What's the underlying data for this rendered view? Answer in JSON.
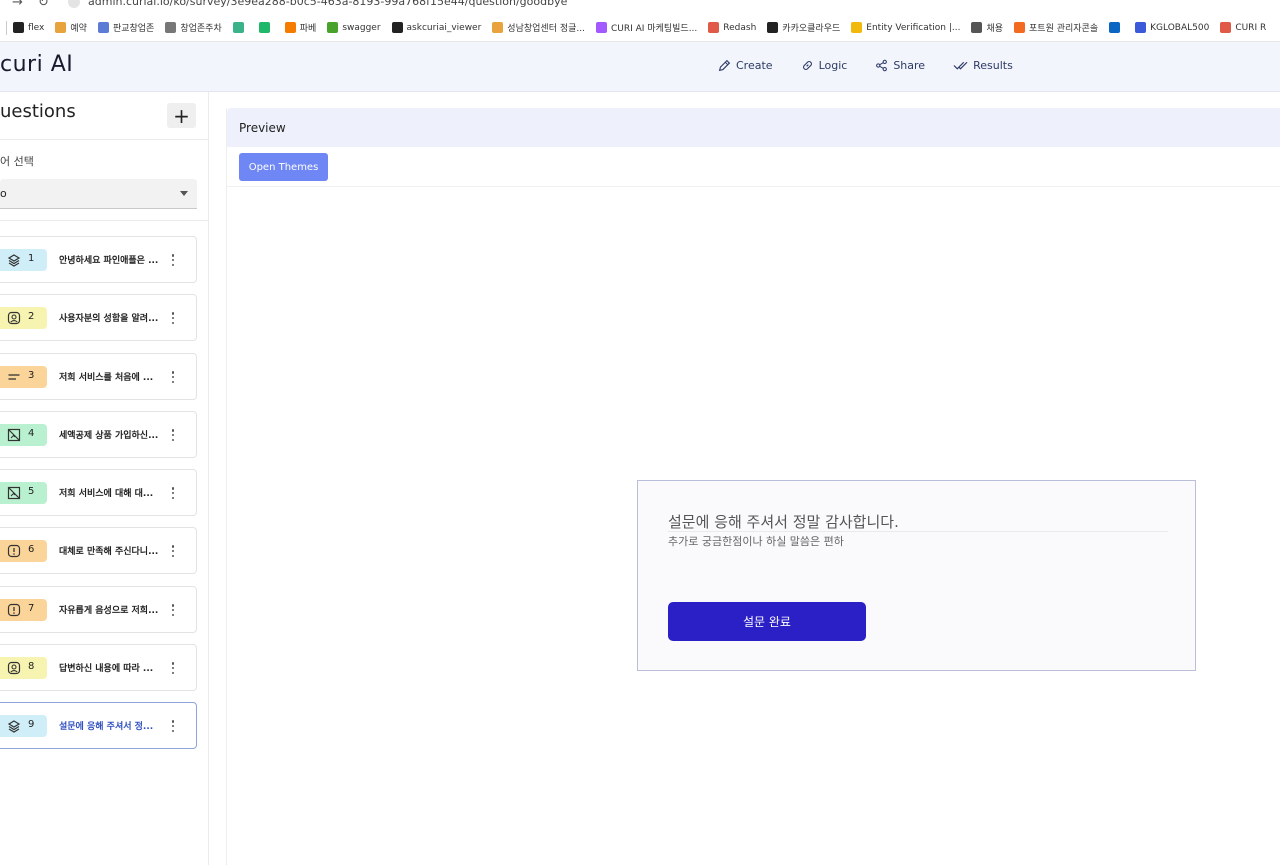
{
  "browser": {
    "url": "admin.curiai.io/ko/survey/3e9ea288-b0c5-463a-8193-99a768f15e44/question/goodbye",
    "bookmarks": [
      {
        "label": "flex",
        "icon": "flex-icon",
        "color": "#222222"
      },
      {
        "label": "예약",
        "icon": "folder-icon",
        "color": "#e8a33c"
      },
      {
        "label": "판교창업존",
        "icon": "building-icon",
        "color": "#5b7bd5"
      },
      {
        "label": "창업존주차",
        "icon": "parking-icon",
        "color": "#777777"
      },
      {
        "label": "",
        "icon": "app-icon",
        "color": "#3bb38a"
      },
      {
        "label": "",
        "icon": "notion-like-icon",
        "color": "#1fb86a"
      },
      {
        "label": "파베",
        "icon": "firebase-icon",
        "color": "#f57c00"
      },
      {
        "label": "swagger",
        "icon": "swagger-icon",
        "color": "#49a32b"
      },
      {
        "label": "askcuriai_viewer",
        "icon": "askcuriai-icon",
        "color": "#222222"
      },
      {
        "label": "성남창업센터 정글...",
        "icon": "folder-icon",
        "color": "#e8a33c"
      },
      {
        "label": "CURI AI 마케팅빌드...",
        "icon": "figma-icon",
        "color": "#a259ff"
      },
      {
        "label": "Redash",
        "icon": "redash-icon",
        "color": "#e05a47"
      },
      {
        "label": "카카오클라우드",
        "icon": "kakao-cloud-icon",
        "color": "#222222"
      },
      {
        "label": "Entity Verification |...",
        "icon": "binance-icon",
        "color": "#f0b90b"
      },
      {
        "label": "채용",
        "icon": "folder-icon",
        "color": "#555555"
      },
      {
        "label": "포트원 관리자콘솔",
        "icon": "portone-icon",
        "color": "#f36b21"
      },
      {
        "label": "",
        "icon": "linkedin-icon",
        "color": "#0a66c2"
      },
      {
        "label": "KGLOBAL500",
        "icon": "kglobal-icon",
        "color": "#3a5ad9"
      },
      {
        "label": "CURI R",
        "icon": "redash-icon",
        "color": "#e05a47"
      }
    ]
  },
  "header": {
    "logo": "curi AI",
    "nav": [
      {
        "label": "Create",
        "icon": "pencil-icon"
      },
      {
        "label": "Logic",
        "icon": "link-icon"
      },
      {
        "label": "Share",
        "icon": "share-icon"
      },
      {
        "label": "Results",
        "icon": "check-icon"
      }
    ]
  },
  "sidebar": {
    "title": "uestions",
    "add_label": "+",
    "language_label": "어 선택",
    "language_value": "o",
    "questions": [
      {
        "num": "1",
        "text": "안녕하세요 파인애플은 ...",
        "icon": "layers-icon",
        "badge_color": "#cfeef7"
      },
      {
        "num": "2",
        "text": "사용자분의 성함을 알려...",
        "icon": "user-icon",
        "badge_color": "#f7f3b0"
      },
      {
        "num": "3",
        "text": "저희 서비스를 처음에 ...",
        "icon": "short-text-icon",
        "badge_color": "#fbd49a"
      },
      {
        "num": "4",
        "text": "세액공제 상품 가입하신...",
        "icon": "no-image-icon",
        "badge_color": "#b9f0cf"
      },
      {
        "num": "5",
        "text": "저희 서비스에 대해 대...",
        "icon": "no-image-icon",
        "badge_color": "#b9f0cf"
      },
      {
        "num": "6",
        "text": "대체로 만족해 주신다니...",
        "icon": "info-icon",
        "badge_color": "#fbd49a"
      },
      {
        "num": "7",
        "text": "자유롭게 음성으로 저희...",
        "icon": "info-icon",
        "badge_color": "#fbd49a"
      },
      {
        "num": "8",
        "text": "답변하신 내용에 따라 ...",
        "icon": "user-icon",
        "badge_color": "#f7f3b0"
      },
      {
        "num": "9",
        "text": "설문에 응해 주셔서 정...",
        "icon": "layers-icon",
        "badge_color": "#cfeef7",
        "active": true
      }
    ]
  },
  "main": {
    "preview_label": "Preview",
    "open_themes_label": "Open Themes",
    "card": {
      "title": "설문에 응해 주셔서 정말 감사합니다.",
      "subtitle": "추가로 궁금한점이나 하실 말씀은 편하",
      "button_label": "설문 완료"
    }
  },
  "colors": {
    "accent": "#2b1fc6",
    "open_themes": "#6f86f5",
    "active_text": "#3050c0"
  }
}
